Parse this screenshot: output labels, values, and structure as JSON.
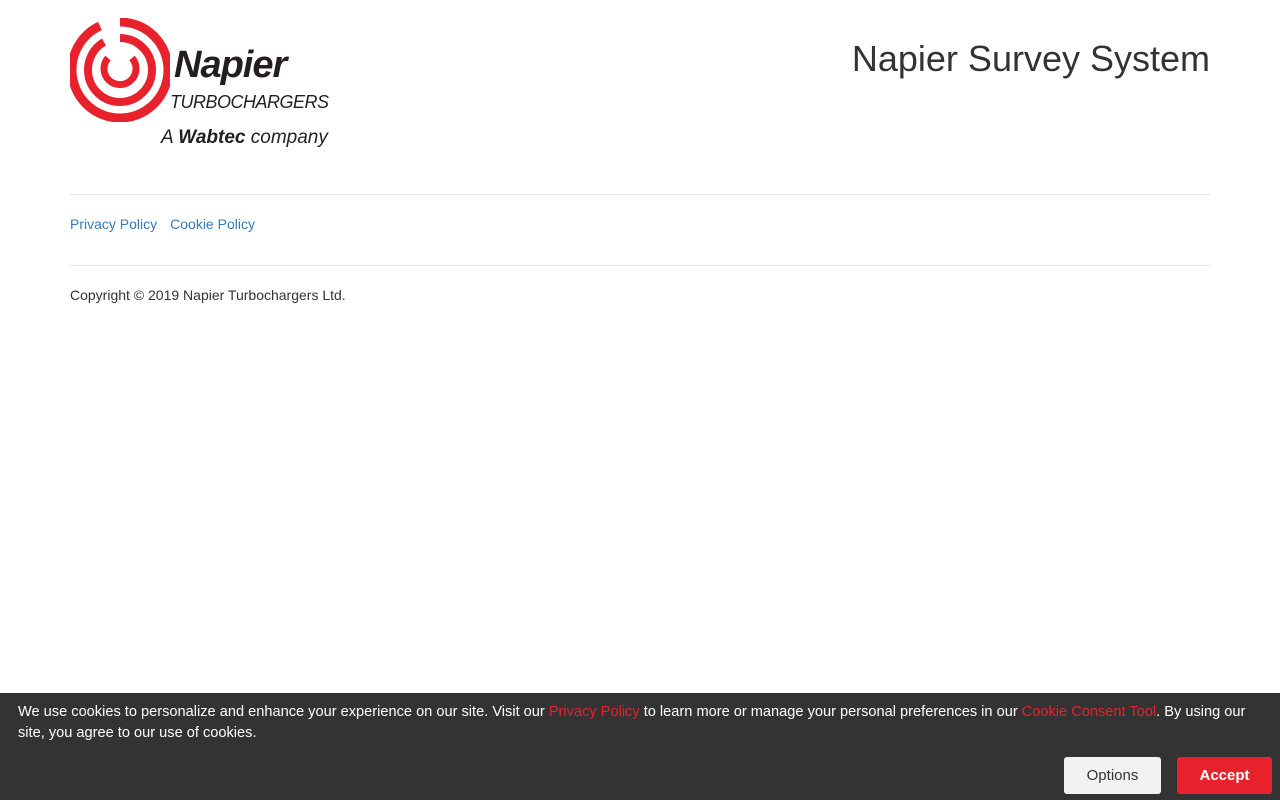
{
  "brand": {
    "logo_name": "Napier",
    "logo_subtitle": "TURBOCHARGERS",
    "logo_tag_prefix": "A",
    "logo_tag_brand": "Wabtec",
    "logo_tag_suffix": "company",
    "logo_icon": "napier-swirl-logo-icon",
    "accent_color": "#e8222d"
  },
  "header": {
    "title": "Napier Survey System"
  },
  "footer": {
    "links": [
      "Privacy Policy",
      "Cookie Policy"
    ],
    "copyright": "Copyright © 2019 Napier Turbochargers Ltd.",
    "link_color": "#337ab7"
  },
  "cookie_banner": {
    "text_1": "We use cookies to personalize and enhance your experience on our site. Visit our ",
    "link_privacy": "Privacy Policy",
    "text_2": " to learn more or manage your personal preferences in our ",
    "link_consent_tool": "Cookie Consent Tool",
    "text_3": ". By using our site, you agree to our use of cookies.",
    "options_label": "Options",
    "accept_label": "Accept",
    "background_color": "#333333"
  }
}
